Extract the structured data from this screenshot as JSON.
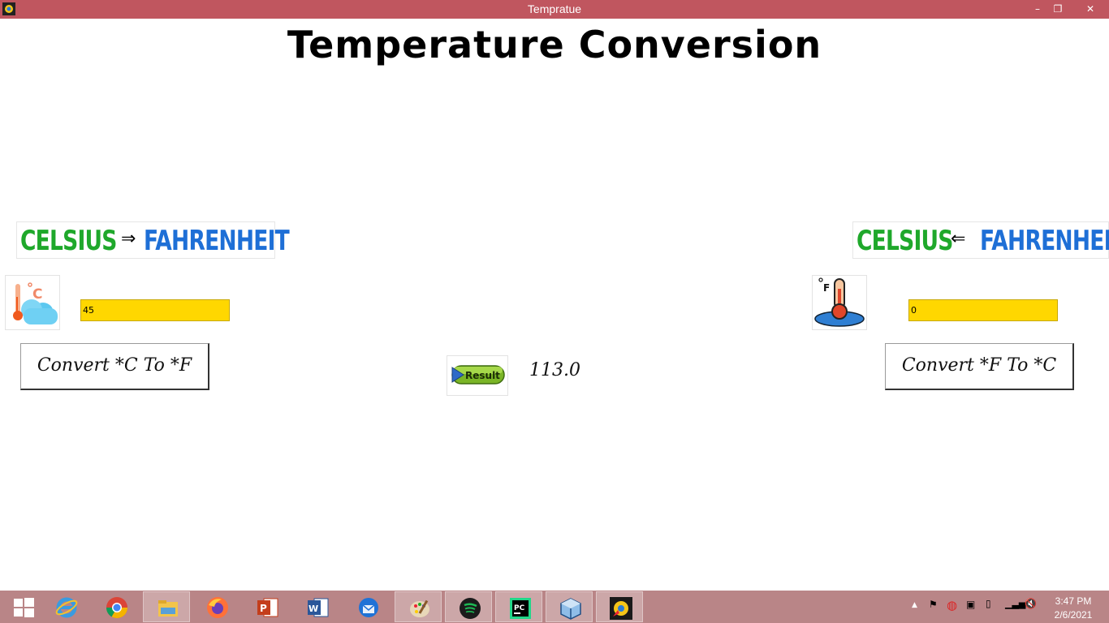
{
  "window": {
    "title": "Tempratue",
    "minimize": "–",
    "restore": "❐",
    "close": "✕"
  },
  "app": {
    "heading": "Temperature Conversion",
    "c_to_f": {
      "from": "CELSIUS",
      "arrow": "⇒",
      "to": "FAHRENHEIT"
    },
    "f_to_c": {
      "to": "CELSIUS",
      "arrow": "⇐",
      "from": "FAHRENHEIT"
    },
    "celsius_input": "45",
    "fahrenheit_input": "0",
    "convert_c_to_f_label": "Convert *C To *F",
    "convert_f_to_c_label": "Convert *F To *C",
    "result_button_label": "Result",
    "result_value": "113.0"
  },
  "taskbar": {
    "apps": [
      "start",
      "internet-explorer",
      "chrome",
      "file-explorer",
      "firefox",
      "powerpoint",
      "word",
      "thunderbird",
      "paint",
      "spotify",
      "pycharm",
      "virtualbox",
      "tempratue"
    ],
    "clock_time": "3:47 PM",
    "clock_date": "2/6/2021"
  },
  "colors": {
    "titlebar": "#c0565f",
    "taskbar": "#b98587",
    "field": "#ffd700",
    "celsius_green": "#1fa82b",
    "fahrenheit_blue": "#1e6fd6"
  }
}
